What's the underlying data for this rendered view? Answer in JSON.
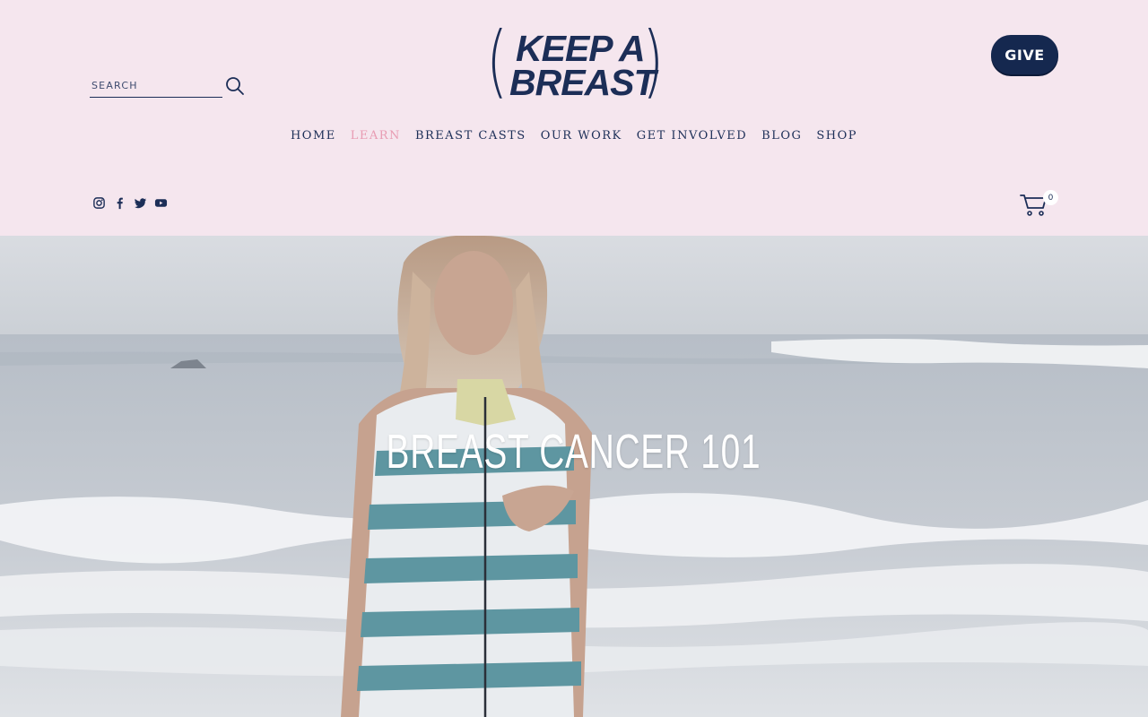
{
  "search": {
    "placeholder": "SEARCH"
  },
  "logo": {
    "line1": "KEEP A",
    "line2": "BREAST",
    "paren_left": "(",
    "paren_right": ")"
  },
  "give_button": {
    "label": "GIVE"
  },
  "nav": {
    "items": [
      {
        "label": "HOME",
        "active": false
      },
      {
        "label": "LEARN",
        "active": true
      },
      {
        "label": "BREAST CASTS",
        "active": false
      },
      {
        "label": "OUR WORK",
        "active": false
      },
      {
        "label": "GET INVOLVED",
        "active": false
      },
      {
        "label": "BLOG",
        "active": false
      },
      {
        "label": "SHOP",
        "active": false
      }
    ]
  },
  "social": {
    "icons": [
      "instagram-icon",
      "facebook-icon",
      "twitter-icon",
      "youtube-icon"
    ]
  },
  "cart": {
    "count": "0",
    "icon": "cart-icon"
  },
  "hero": {
    "title": "BREAST CANCER 101"
  },
  "colors": {
    "background": "#f5e6ee",
    "navy": "#1c2e57",
    "accent_pink": "#e89bb2",
    "give_bg": "#15284f"
  }
}
